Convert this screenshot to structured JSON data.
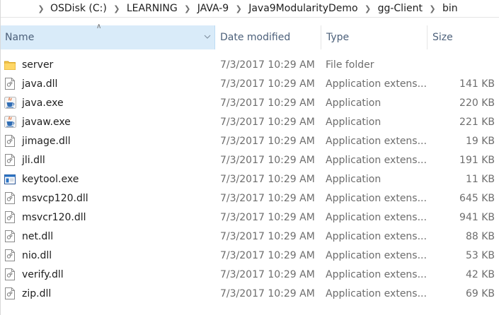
{
  "breadcrumb": {
    "items": [
      "OSDisk (C:)",
      "LEARNING",
      "JAVA-9",
      "Java9ModularityDemo",
      "gg-Client",
      "bin"
    ]
  },
  "columns": {
    "name": "Name",
    "date": "Date modified",
    "type": "Type",
    "size": "Size",
    "sort": "ascending"
  },
  "files": [
    {
      "name": "server",
      "date": "7/3/2017 10:29 AM",
      "type": "File folder",
      "size": "",
      "icon": "folder-icon"
    },
    {
      "name": "java.dll",
      "date": "7/3/2017 10:29 AM",
      "type": "Application extens...",
      "size": "141 KB",
      "icon": "dll-file-icon"
    },
    {
      "name": "java.exe",
      "date": "7/3/2017 10:29 AM",
      "type": "Application",
      "size": "220 KB",
      "icon": "java-exe-icon"
    },
    {
      "name": "javaw.exe",
      "date": "7/3/2017 10:29 AM",
      "type": "Application",
      "size": "221 KB",
      "icon": "java-exe-icon"
    },
    {
      "name": "jimage.dll",
      "date": "7/3/2017 10:29 AM",
      "type": "Application extens...",
      "size": "19 KB",
      "icon": "dll-file-icon"
    },
    {
      "name": "jli.dll",
      "date": "7/3/2017 10:29 AM",
      "type": "Application extens...",
      "size": "191 KB",
      "icon": "dll-file-icon"
    },
    {
      "name": "keytool.exe",
      "date": "7/3/2017 10:29 AM",
      "type": "Application",
      "size": "11 KB",
      "icon": "app-window-icon"
    },
    {
      "name": "msvcp120.dll",
      "date": "7/3/2017 10:29 AM",
      "type": "Application extens...",
      "size": "645 KB",
      "icon": "dll-file-icon"
    },
    {
      "name": "msvcr120.dll",
      "date": "7/3/2017 10:29 AM",
      "type": "Application extens...",
      "size": "941 KB",
      "icon": "dll-file-icon"
    },
    {
      "name": "net.dll",
      "date": "7/3/2017 10:29 AM",
      "type": "Application extens...",
      "size": "88 KB",
      "icon": "dll-file-icon"
    },
    {
      "name": "nio.dll",
      "date": "7/3/2017 10:29 AM",
      "type": "Application extens...",
      "size": "53 KB",
      "icon": "dll-file-icon"
    },
    {
      "name": "verify.dll",
      "date": "7/3/2017 10:29 AM",
      "type": "Application extens...",
      "size": "42 KB",
      "icon": "dll-file-icon"
    },
    {
      "name": "zip.dll",
      "date": "7/3/2017 10:29 AM",
      "type": "Application extens...",
      "size": "69 KB",
      "icon": "dll-file-icon"
    }
  ],
  "colors": {
    "header_selected_bg": "#d9ebf9",
    "header_text": "#4c607a",
    "secondary_text": "#6d6d6d"
  }
}
